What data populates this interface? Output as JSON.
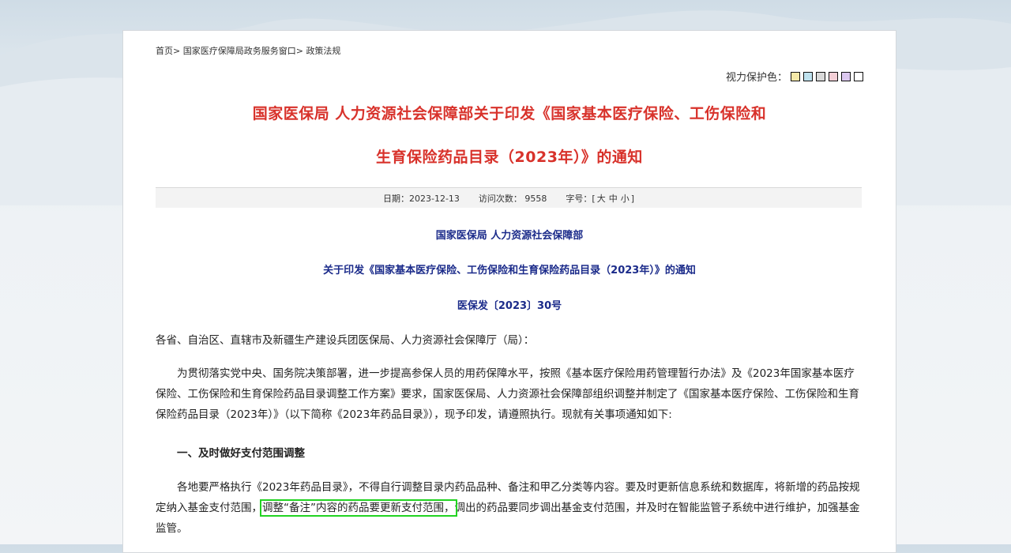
{
  "breadcrumb": {
    "home": "首页",
    "sep1": "> ",
    "window": "国家医疗保障局政务服务窗口",
    "sep2": "> ",
    "current": "政策法规"
  },
  "vision": {
    "label": "视力保护色：",
    "swatches": [
      "#f5e9a8",
      "#bfe2ef",
      "#d9d9d9",
      "#f3cfd6",
      "#dcc8ef",
      "#ffffff"
    ]
  },
  "title": {
    "line1": "国家医保局 人力资源社会保障部关于印发《国家基本医疗保险、工伤保险和",
    "line2": "生育保险药品目录（2023年）》的通知"
  },
  "meta": {
    "date": "日期：2023-12-13",
    "visits": "访问次数：  9558",
    "font_label": "字号：[",
    "font_large": "大",
    "font_medium": "中",
    "font_small": "小",
    "font_end": "]"
  },
  "subtitle": {
    "issuer": "国家医保局 人力资源社会保障部",
    "doc_title": "关于印发《国家基本医疗保险、工伤保险和生育保险药品目录（2023年）》的通知",
    "doc_number": "医保发〔2023〕30号"
  },
  "body": {
    "salutation": "各省、自治区、直辖市及新疆生产建设兵团医保局、人力资源社会保障厅（局）：",
    "para1": "为贯彻落实党中央、国务院决策部署，进一步提高参保人员的用药保障水平，按照《基本医疗保险用药管理暂行办法》及《2023年国家基本医疗保险、工伤保险和生育保险药品目录调整工作方案》要求，国家医保局、人力资源社会保障部组织调整并制定了《国家基本医疗保险、工伤保险和生育保险药品目录（2023年）》（以下简称《2023年药品目录》），现予印发，请遵照执行。现就有关事项通知如下:",
    "heading1": "一、及时做好支付范围调整",
    "para2_a": "各地要严格执行《2023年药品目录》，不得自行调整目录内药品品种、备注和甲乙分类等内容。要及时更新信息系统和数据库，将新增的药品按规定纳入基金支付范围，",
    "para2_highlight": "调整“备注”内容的药品要更新支付范围，",
    "para2_b": "调出的药品要同步调出基金支付范围，并及时在智能监管子系统中进行维护，加强基金监管。"
  }
}
